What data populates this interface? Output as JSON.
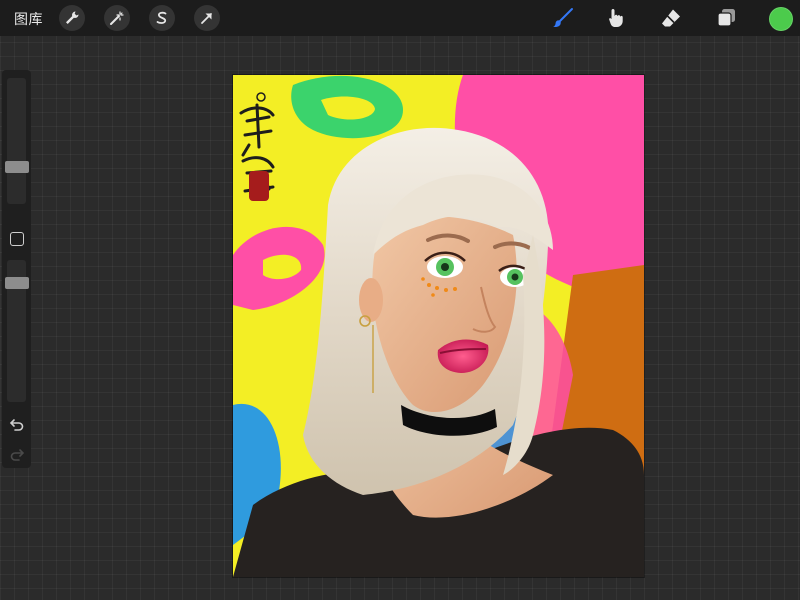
{
  "topbar": {
    "gallery_label": "图库",
    "left_tools": [
      "wrench-icon",
      "magic-wand-icon",
      "selection-icon",
      "move-arrow-icon"
    ],
    "right_tools": [
      "brush-icon",
      "smudge-icon",
      "eraser-icon",
      "layers-icon"
    ],
    "active_tool": "brush-icon",
    "current_color": "#4ccb4c"
  },
  "sidebar": {
    "brush_size_level": 0.27,
    "opacity_level": 0.87
  },
  "colors": {
    "accent_blue": "#3478f6",
    "bg": "#2b2b2b"
  }
}
